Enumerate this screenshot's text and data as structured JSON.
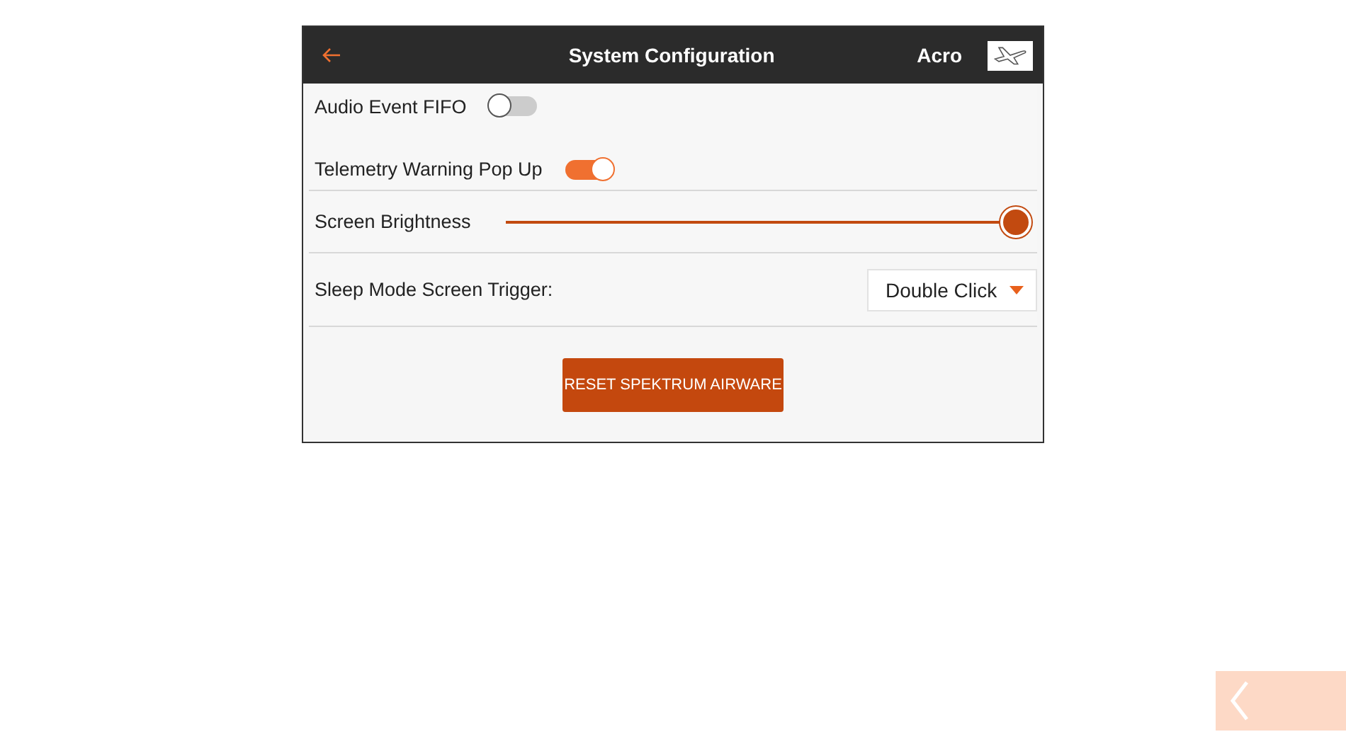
{
  "header": {
    "title": "System Configuration",
    "model_name": "Acro"
  },
  "settings": [
    {
      "kind": "toggle",
      "label": "Audio Event FIFO",
      "on": false,
      "divider": false
    },
    {
      "kind": "toggle",
      "label": "Telemetry Warning Pop Up",
      "on": true,
      "divider": true
    },
    {
      "kind": "slider",
      "label": "Screen Brightness",
      "level": 1.0,
      "divider": true
    },
    {
      "kind": "dropdown",
      "label": "Sleep Mode Screen Trigger:",
      "value": "Double Click",
      "divider": true
    }
  ],
  "reset_button": "RESET SPEKTRUM AIRWARE"
}
